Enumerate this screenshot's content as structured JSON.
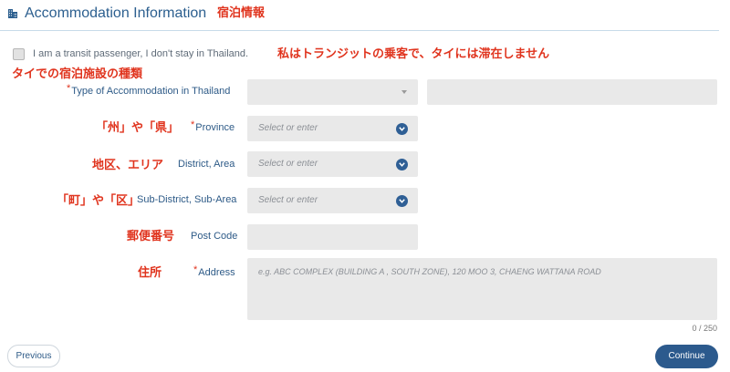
{
  "header": {
    "title": "Accommodation Information",
    "annotation": "宿泊情報"
  },
  "transit": {
    "label": "I am a transit passenger, I don't stay in Thailand.",
    "annotation": "私はトランジットの乗客で、タイには滞在しません",
    "checked": false
  },
  "accommodation_type": {
    "annotation": "タイでの宿泊施設の種類",
    "required_mark": "*",
    "label": "Type of Accommodation in Thailand"
  },
  "province": {
    "annotation": "「州」や「県」",
    "required_mark": "*",
    "label": "Province",
    "placeholder": "Select or enter"
  },
  "district": {
    "annotation": "地区、エリア",
    "label": "District, Area",
    "placeholder": "Select or enter"
  },
  "sub_district": {
    "annotation": "「町」や「区」",
    "label": "Sub-District, Sub-Area",
    "placeholder": "Select or enter"
  },
  "post_code": {
    "annotation": "郵便番号",
    "label": "Post Code"
  },
  "address": {
    "annotation": "住所",
    "required_mark": "*",
    "label": "Address",
    "placeholder": "e.g. ABC COMPLEX (BUILDING A , SOUTH ZONE), 120 MOO 3, CHAENG WATTANA ROAD",
    "counter": "0 / 250"
  },
  "buttons": {
    "previous": "Previous",
    "continue": "Continue"
  },
  "colors": {
    "label_blue": "#2d5a87",
    "annotation_red": "#e0341e",
    "field_gray": "#e9e9e9",
    "primary_button": "#2c5a8d"
  }
}
